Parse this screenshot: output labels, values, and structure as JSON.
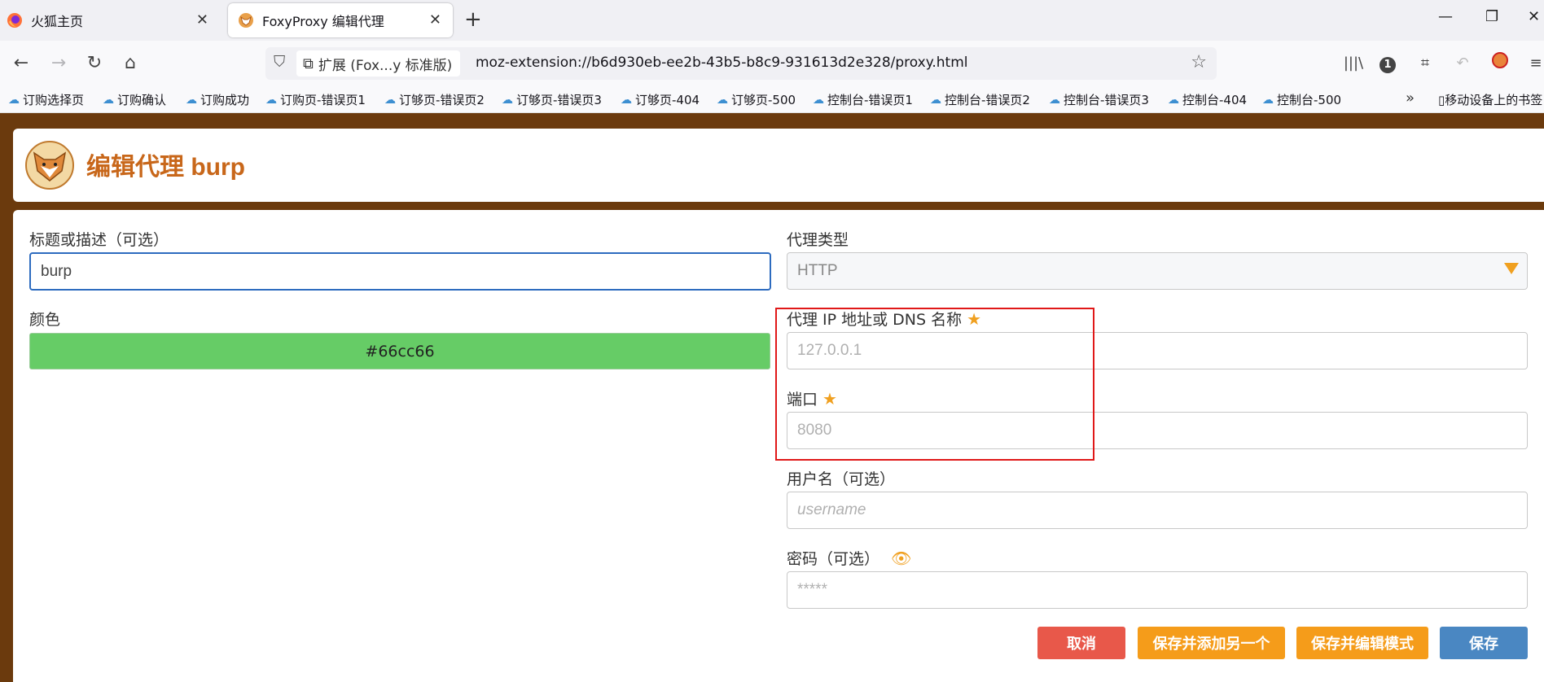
{
  "tabs": [
    {
      "title": "火狐主页",
      "icon": "firefox-icon"
    },
    {
      "title": "FoxyProxy 编辑代理",
      "icon": "foxyproxy-icon"
    }
  ],
  "url": {
    "extension_chip": "扩展 (Fox...y 标准版)",
    "address": "moz-extension://b6d930eb-ee2b-43b5-b8c9-931613d2e328/proxy.html"
  },
  "toolbar": {
    "badge_count": "1"
  },
  "bookmarks": [
    "订购选择页",
    "订购确认",
    "订购成功",
    "订购页-错误页1",
    "订够页-错误页2",
    "订够页-错误页3",
    "订够页-404",
    "订够页-500",
    "控制台-错误页1",
    "控制台-错误页2",
    "控制台-错误页3",
    "控制台-404",
    "控制台-500"
  ],
  "bookmarks_mobile": "移动设备上的书签",
  "page": {
    "title": "编辑代理 burp"
  },
  "form": {
    "title_label": "标题或描述（可选）",
    "title_value": "burp",
    "color_label": "颜色",
    "color_value": "#66cc66",
    "type_label": "代理类型",
    "type_value": "HTTP",
    "host_label": "代理 IP 地址或 DNS 名称",
    "host_placeholder": "127.0.0.1",
    "port_label": "端口",
    "port_placeholder": "8080",
    "user_label": "用户名（可选）",
    "user_placeholder": "username",
    "pass_label": "密码（可选）",
    "pass_placeholder": "*****"
  },
  "buttons": {
    "cancel": "取消",
    "save_add": "保存并添加另一个",
    "save_edit": "保存并编辑模式",
    "save": "保存"
  },
  "colors": {
    "accent": "#c8671a",
    "color_swatch": "#66cc66",
    "cancel": "#e8584a",
    "orange": "#f59c1a",
    "save": "#4a87c2",
    "page_bg": "#6b3a0d"
  }
}
